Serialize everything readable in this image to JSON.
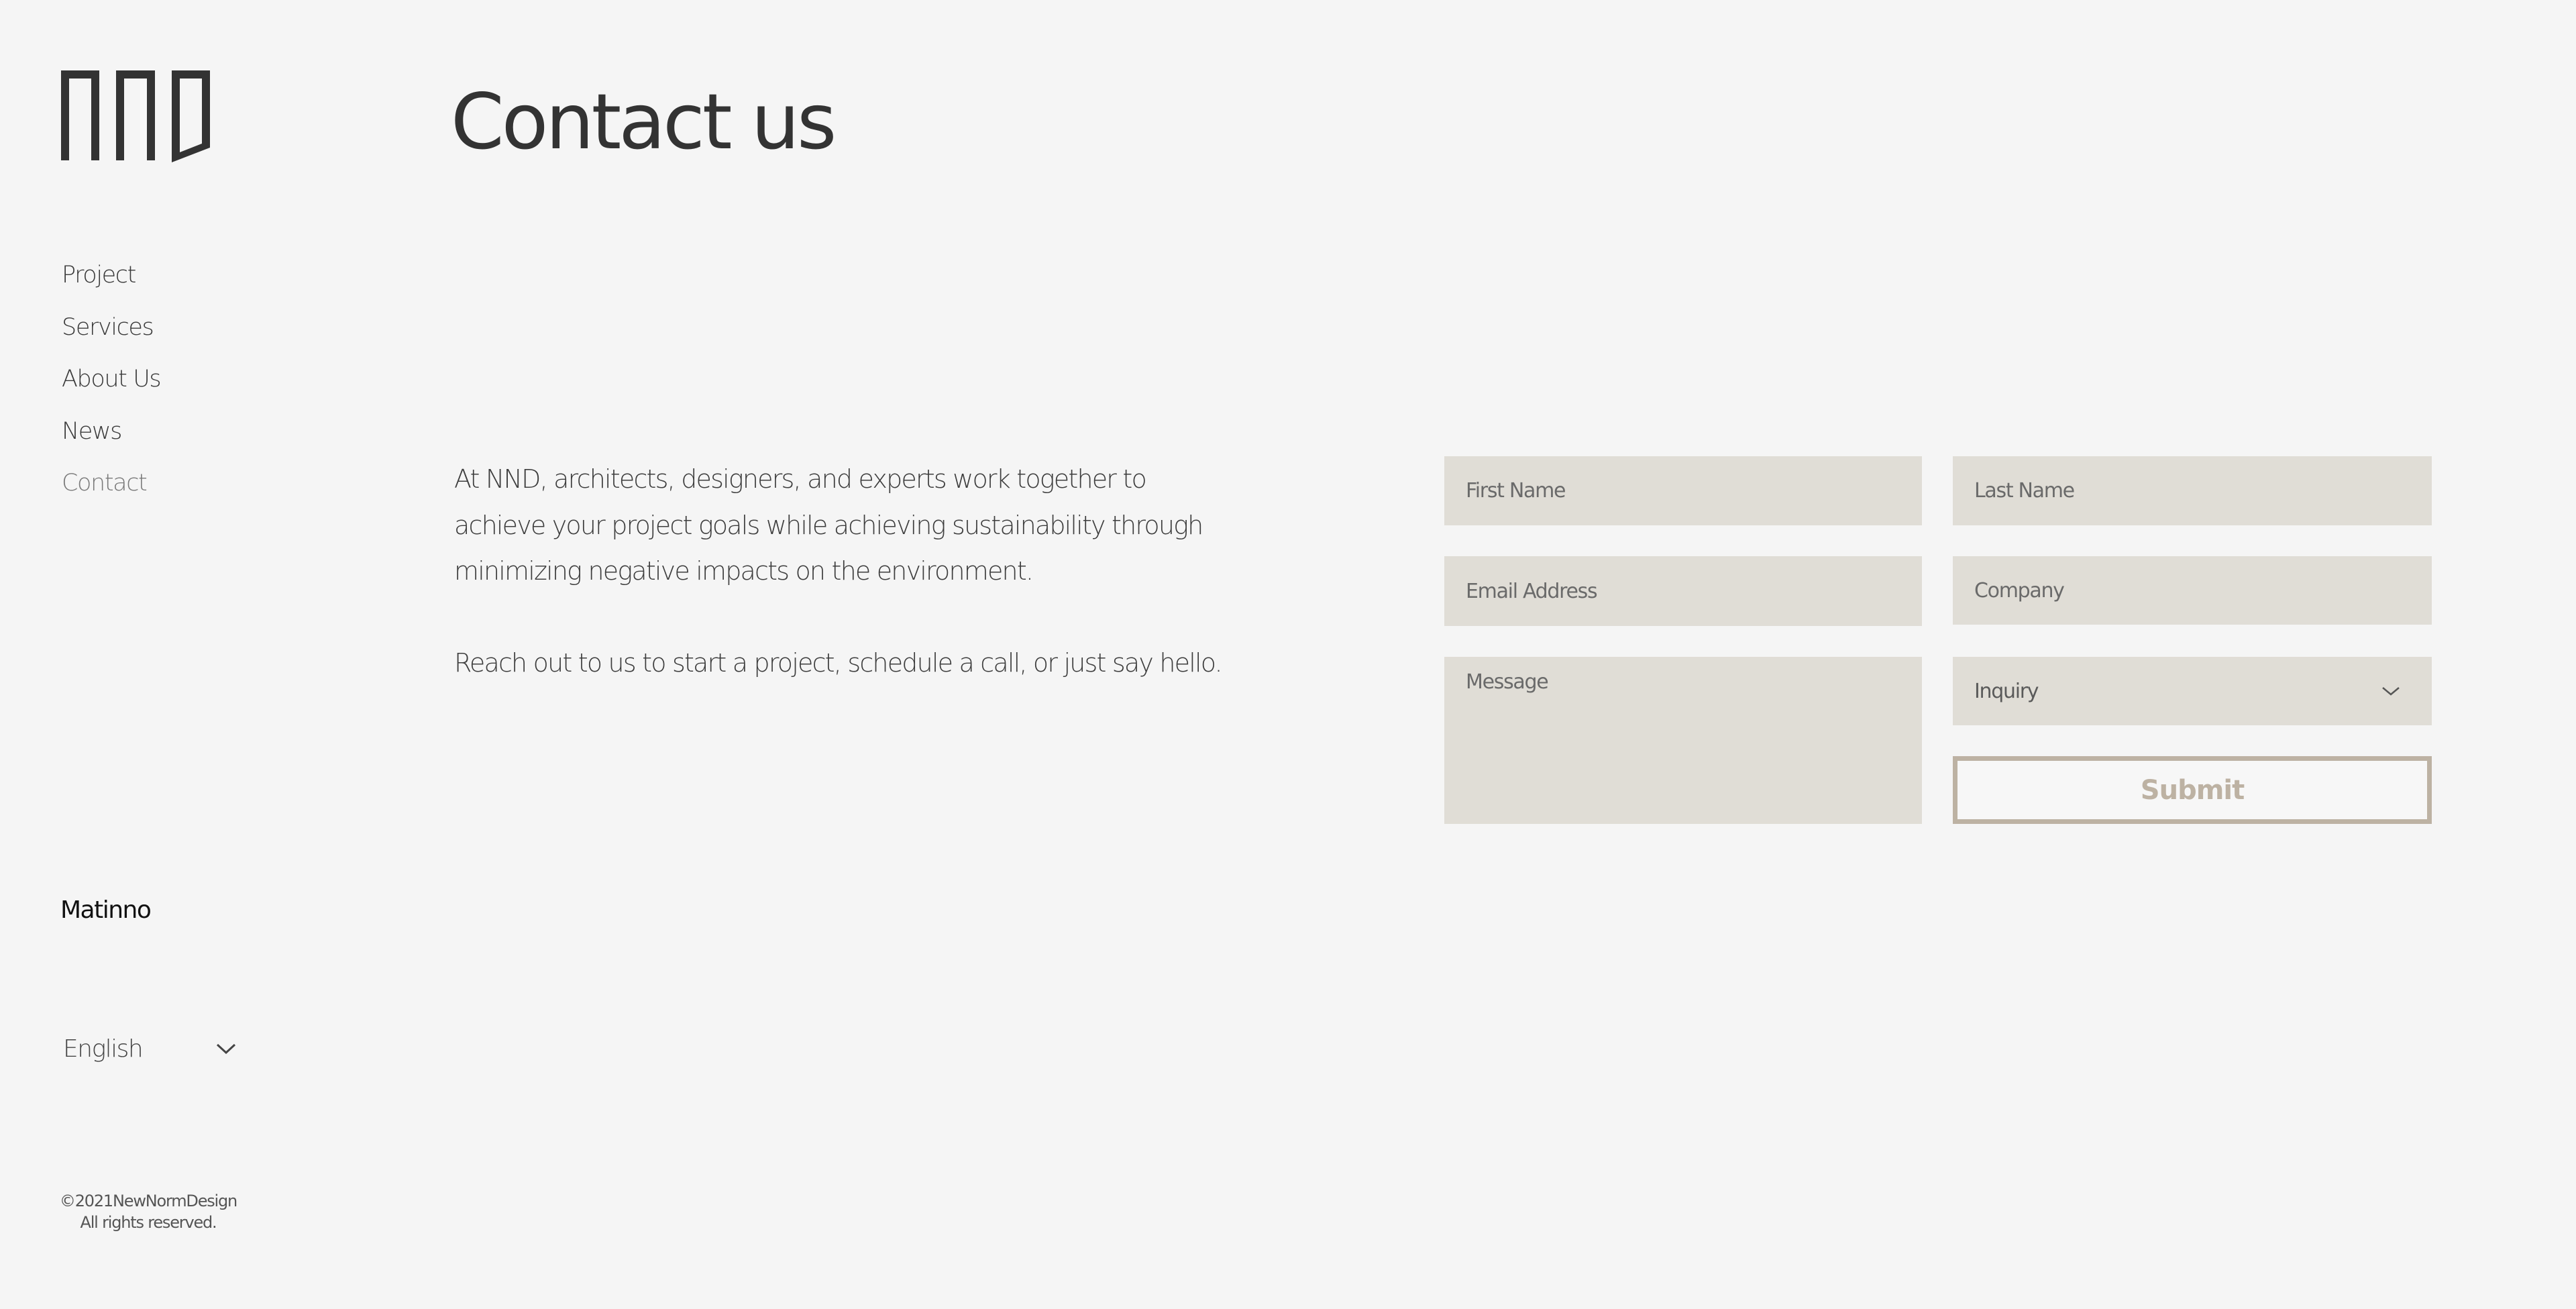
{
  "brand": {
    "logo_alt": "NND",
    "name": "Matinno"
  },
  "nav": {
    "items": [
      {
        "label": "Project",
        "active": false
      },
      {
        "label": "Services",
        "active": false
      },
      {
        "label": "About Us",
        "active": false
      },
      {
        "label": "News",
        "active": false
      },
      {
        "label": "Contact",
        "active": true
      }
    ]
  },
  "language": {
    "selected": "English",
    "icon": "chevron-down-icon"
  },
  "footer": {
    "copyright": "©2021NewNormDesign",
    "rights": "All rights reserved."
  },
  "page": {
    "title": "Contact us",
    "intro": [
      "At NND, architects, designers, and experts work together to achieve your project goals while achieving sustainability through minimizing negative impacts on the environment.",
      "Reach out to us to start a project, schedule a call, or just say hello."
    ]
  },
  "form": {
    "first_name": {
      "placeholder": "First Name",
      "value": ""
    },
    "last_name": {
      "placeholder": "Last Name",
      "value": ""
    },
    "email": {
      "placeholder": "Email Address",
      "value": ""
    },
    "company": {
      "placeholder": "Company",
      "value": ""
    },
    "message": {
      "placeholder": "Message",
      "value": ""
    },
    "inquiry": {
      "selected": "Inquiry",
      "icon": "chevron-down-icon"
    },
    "submit_label": "Submit"
  },
  "colors": {
    "background": "#f5f5f5",
    "field_bg": "#e0ddd6",
    "accent": "#bdb2a3",
    "text": "#333333"
  }
}
